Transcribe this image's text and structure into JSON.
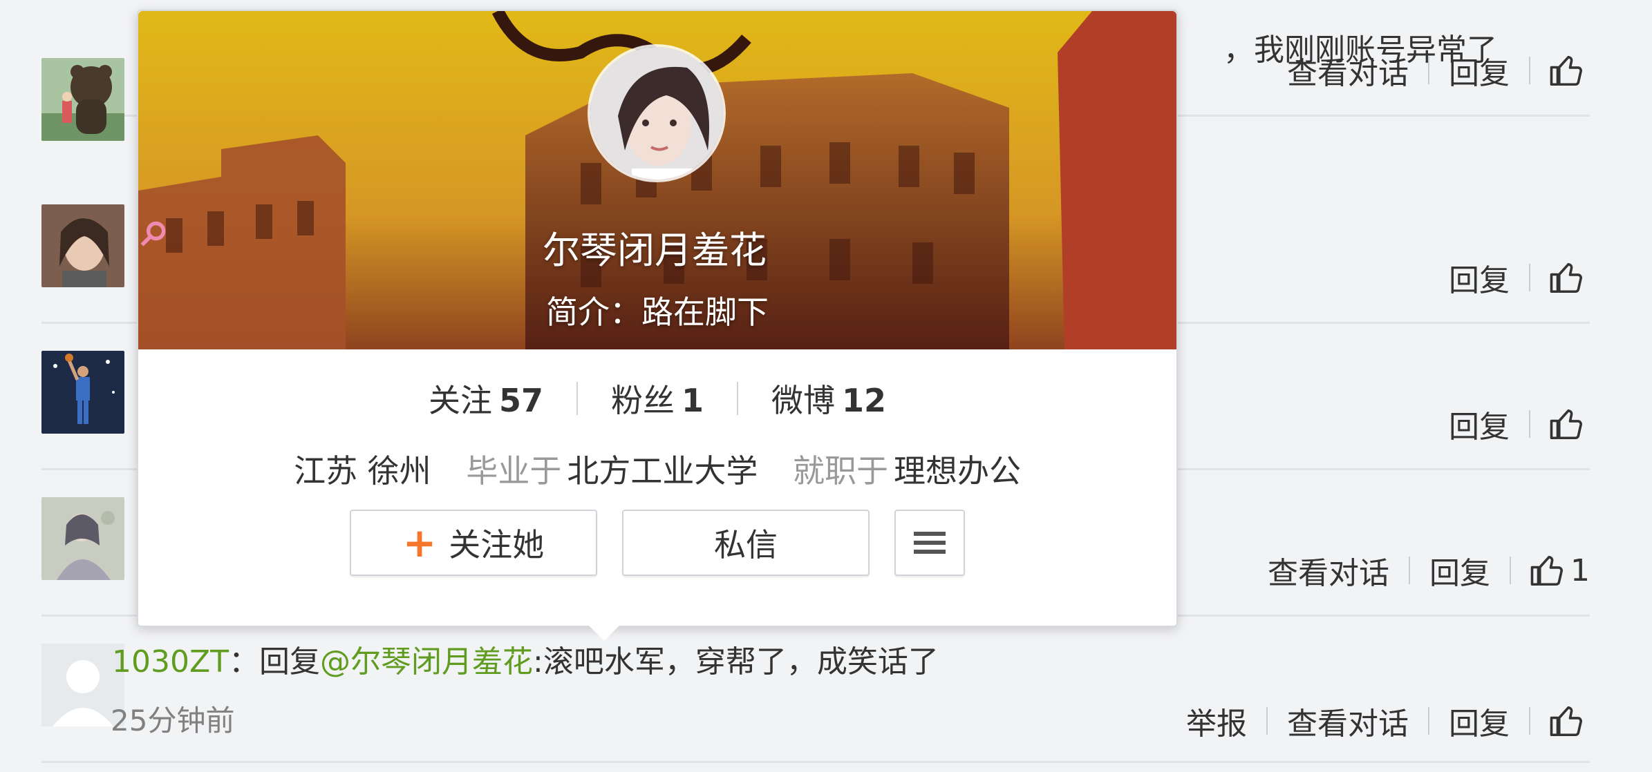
{
  "comments": [
    {
      "snippet": "，我刚刚账号异常了",
      "actions": [
        "查看对话",
        "回复"
      ],
      "like_count": ""
    },
    {
      "snippet": "",
      "actions": [
        "回复"
      ],
      "like_count": ""
    },
    {
      "snippet": "",
      "actions": [
        "回复"
      ],
      "like_count": ""
    },
    {
      "snippet": "",
      "actions": [
        "查看对话",
        "回复"
      ],
      "like_count": "1"
    },
    {
      "user": "1030ZT",
      "colon": "：",
      "reply_prefix": "回复",
      "mention": "@尔琴闭月羞花",
      "text": ":滚吧水军，穿帮了，成笑话了",
      "time": "25分钟前",
      "actions": [
        "举报",
        "查看对话",
        "回复"
      ],
      "like_count": ""
    }
  ],
  "popup": {
    "name": "尔琴闭月羞花",
    "intro": "简介：路在脚下",
    "stats": [
      {
        "label": "关注",
        "value": "57"
      },
      {
        "label": "粉丝",
        "value": "1"
      },
      {
        "label": "微博",
        "value": "12"
      }
    ],
    "location": "江苏 徐州",
    "edu_label": "毕业于",
    "edu_value": "北方工业大学",
    "job_label": "就职于",
    "job_value": "理想办公",
    "follow_button": "关注她",
    "message_button": "私信",
    "gender_icon": "female-icon",
    "more_icon": "menu-icon"
  },
  "colors": {
    "link_green": "#5f9c20",
    "follow_plus": "#f7772a",
    "gender_pink": "#f08ab0"
  }
}
